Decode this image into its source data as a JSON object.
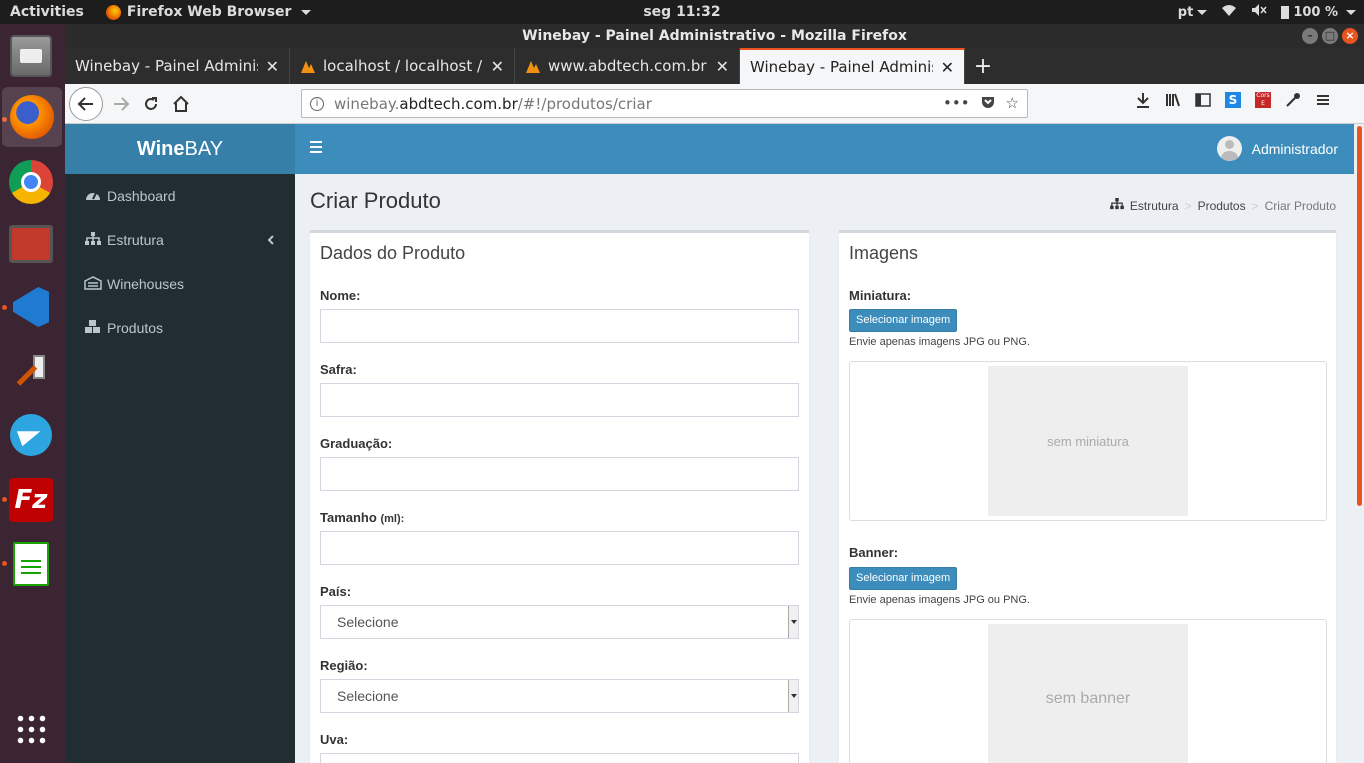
{
  "os": {
    "activities": "Activities",
    "app_menu": "Firefox Web Browser",
    "clock": "seg 11:32",
    "lang": "pt",
    "battery": "100 %"
  },
  "window": {
    "title": "Winebay - Painel Administrativo - Mozilla Firefox"
  },
  "tabs": [
    {
      "label": "Winebay - Painel Administrativo",
      "icon": "document-icon"
    },
    {
      "label": "localhost / localhost / winebay",
      "icon": "phpmyadmin-icon"
    },
    {
      "label": "www.abdtech.com.br / localhost",
      "icon": "phpmyadmin-icon"
    },
    {
      "label": "Winebay - Painel Administrativo",
      "icon": "document-icon"
    }
  ],
  "url": {
    "prefix": "winebay.",
    "domain": "abdtech.com.br",
    "path": "/#!/produtos/criar"
  },
  "app": {
    "logo_bold": "Wine",
    "logo_rest": "BAY",
    "user": "Administrador"
  },
  "sidebar": {
    "items": [
      {
        "label": "Dashboard",
        "icon": "dashboard-icon"
      },
      {
        "label": "Estrutura",
        "icon": "sitemap-icon"
      },
      {
        "label": "Winehouses",
        "icon": "building-icon"
      },
      {
        "label": "Produtos",
        "icon": "cubes-icon"
      }
    ]
  },
  "content": {
    "title": "Criar Produto",
    "breadcrumb": [
      "Estrutura",
      "Produtos",
      "Criar Produto"
    ]
  },
  "form": {
    "title": "Dados do Produto",
    "nome": "Nome:",
    "safra": "Safra:",
    "graduacao": "Graduação:",
    "tamanho": "Tamanho",
    "tamanho_unit": "(ml):",
    "pais": "País:",
    "pais_value": "Selecione",
    "regiao": "Região:",
    "regiao_value": "Selecione",
    "uva": "Uva:"
  },
  "images": {
    "title": "Imagens",
    "miniatura_label": "Miniatura:",
    "button": "Selecionar imagem",
    "help": "Envie apenas imagens JPG ou PNG.",
    "miniatura_placeholder": "sem miniatura",
    "banner_label": "Banner:",
    "banner_placeholder": "sem banner"
  }
}
